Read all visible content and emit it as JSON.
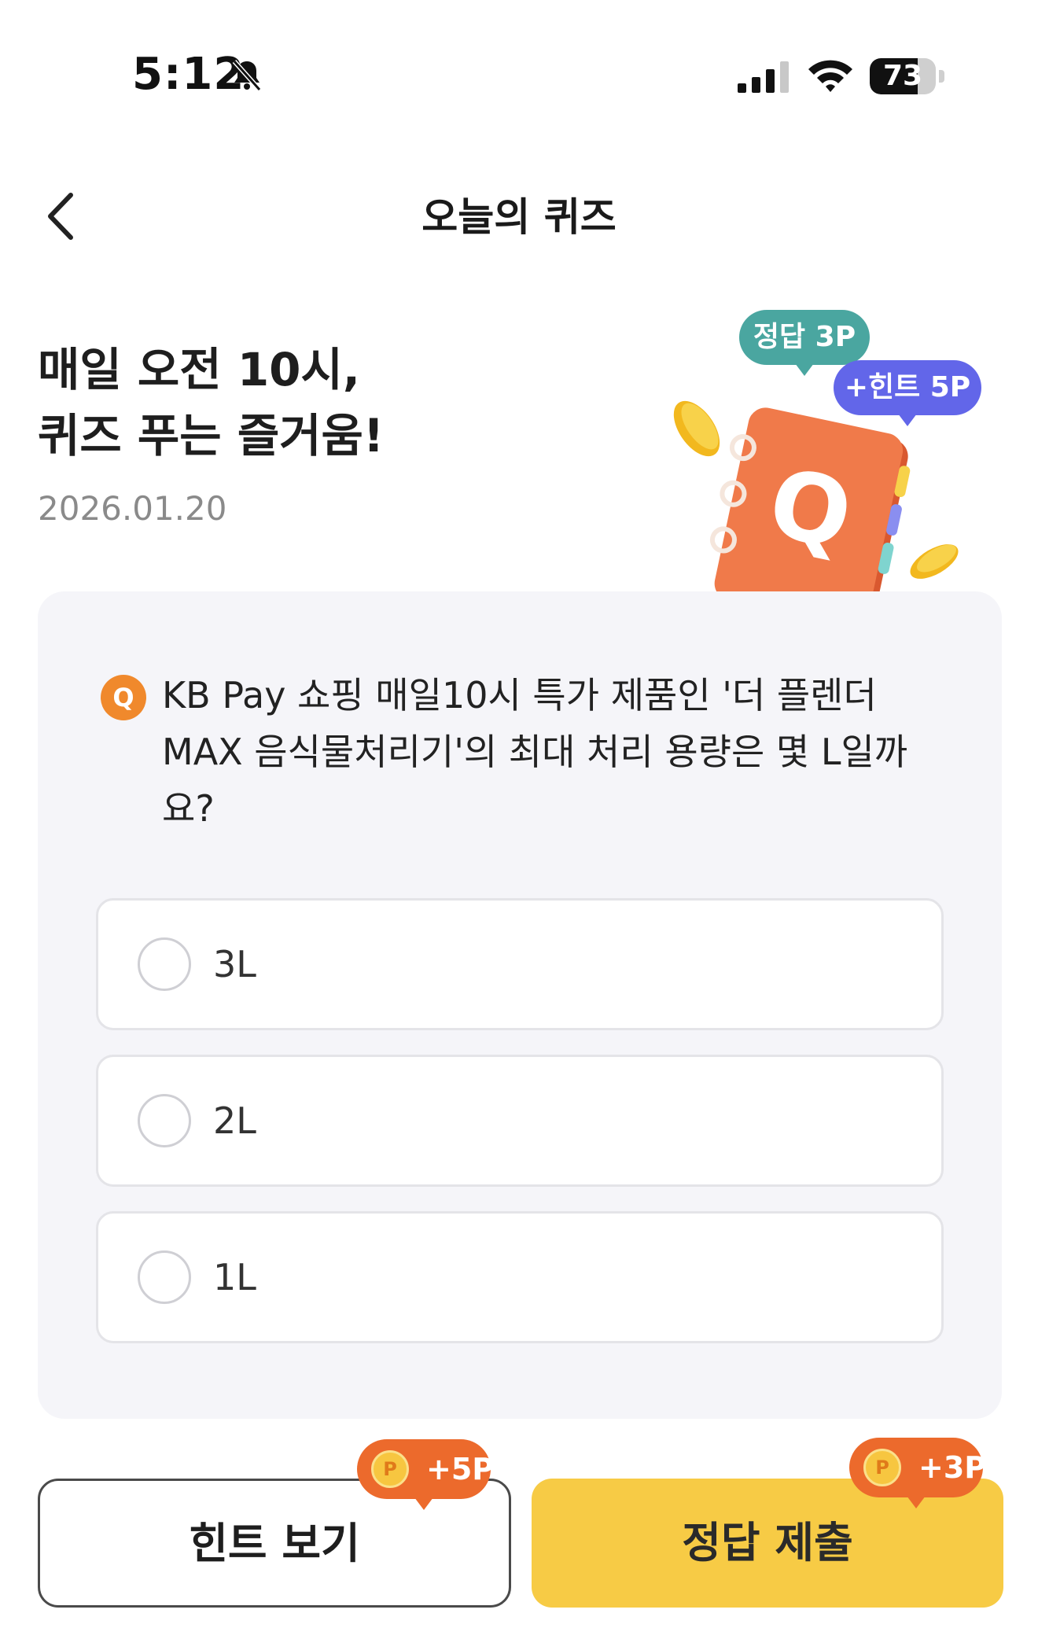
{
  "status_bar": {
    "time": "5:12",
    "battery": "73",
    "battery_level": 0.73
  },
  "header": {
    "title": "오늘의 퀴즈"
  },
  "hero": {
    "title_line1": "매일 오전 10시,",
    "title_line2": "퀴즈 푸는 즐거움!",
    "date": "2026.01.20",
    "bubble_answer": "정답 3P",
    "bubble_hint": "+힌트 5P",
    "badge_letter": "Q"
  },
  "quiz": {
    "badge": "Q",
    "question": "KB Pay 쇼핑 매일10시 특가 제품인 '더 플렌더 MAX 음식물처리기'의 최대 처리 용량은 몇 L일까요?",
    "options": [
      {
        "label": "3L"
      },
      {
        "label": "2L"
      },
      {
        "label": "1L"
      }
    ]
  },
  "actions": {
    "hint_label": "힌트 보기",
    "hint_reward": "+5P",
    "submit_label": "정답 제출",
    "submit_reward": "+3P",
    "coin_letter": "P"
  },
  "colors": {
    "accent_yellow": "#f7cb45",
    "reward_orange": "#ec6a2c",
    "teal_bubble": "#4aa6a0",
    "purple_bubble": "#6266e9",
    "q_badge": "#f0892c"
  }
}
